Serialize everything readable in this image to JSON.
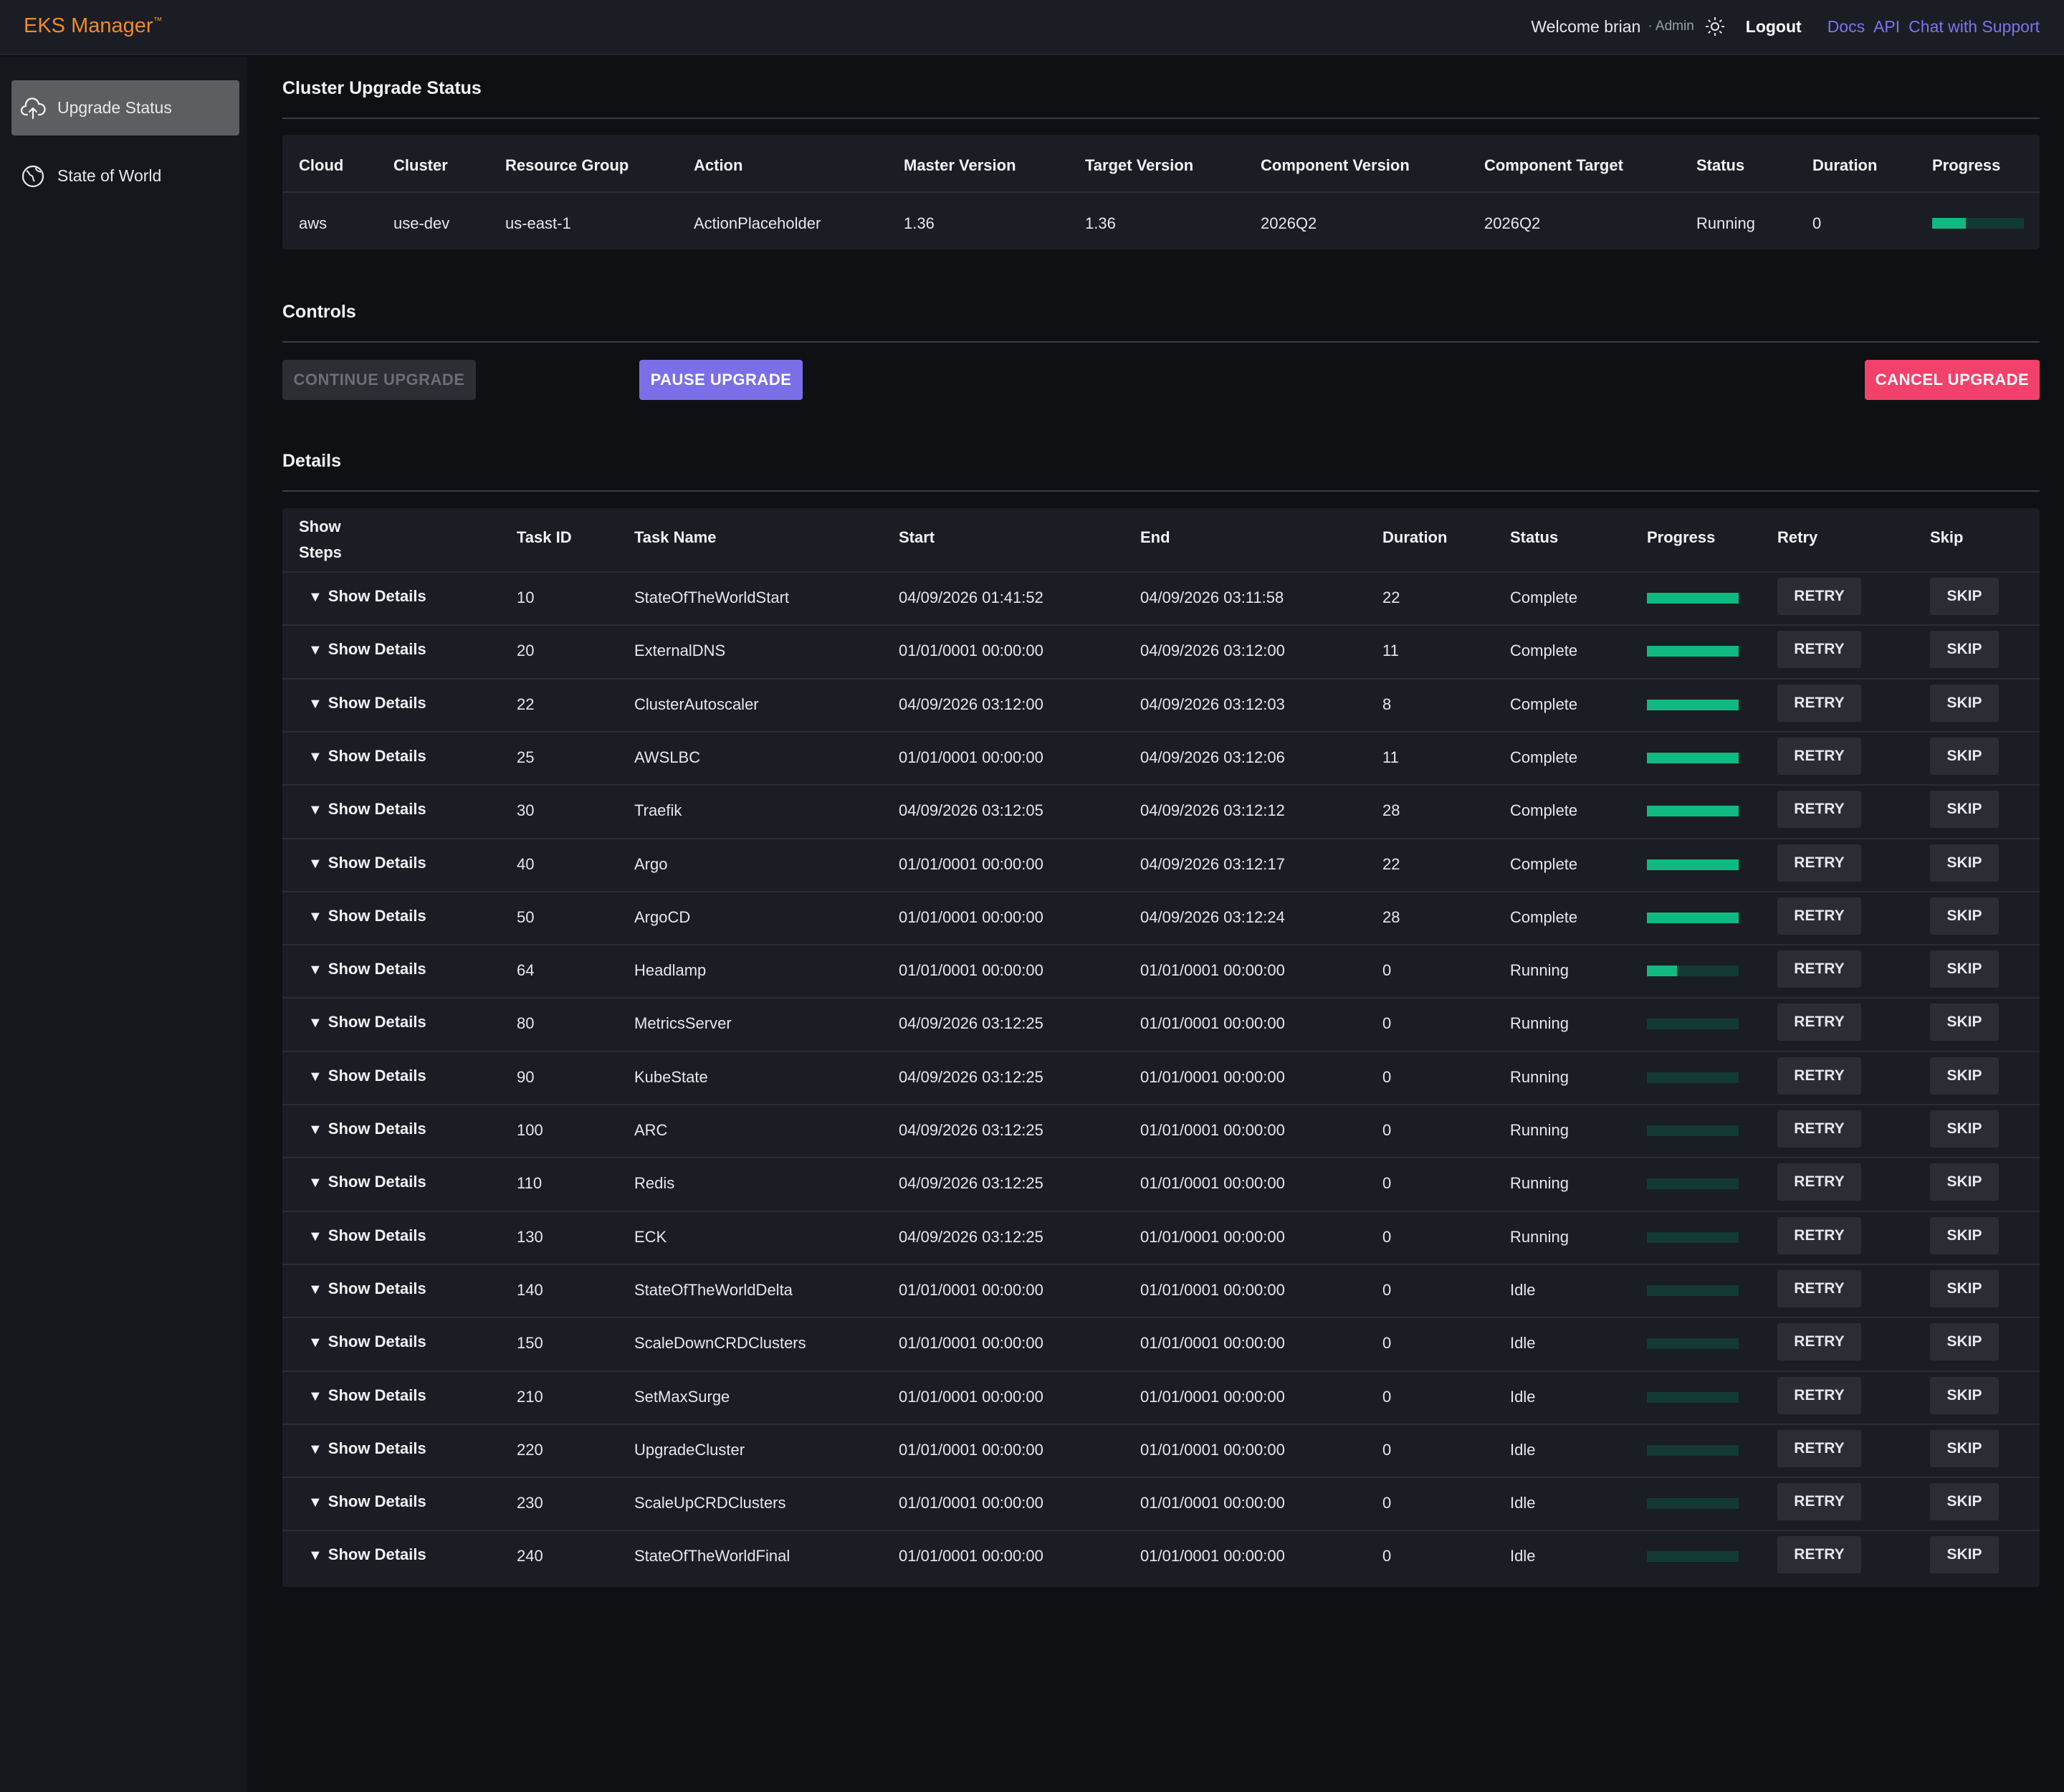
{
  "header": {
    "brand": "EKS Manager",
    "trademark": "™",
    "welcome": "Welcome brian",
    "role": "· Admin",
    "theme_icon": "sun-icon",
    "logout": "Logout",
    "links": [
      "Docs",
      "API",
      "Chat with Support"
    ],
    "colors": {
      "brand": "#f08a2a",
      "link": "#7c74f2"
    }
  },
  "sidebar": {
    "items": [
      {
        "label": "Upgrade Status",
        "icon": "cloud-upload-icon",
        "active": true
      },
      {
        "label": "State of World",
        "icon": "globe-icon",
        "active": false
      }
    ]
  },
  "upgrade_status": {
    "title": "Cluster Upgrade Status",
    "columns": [
      "Cloud",
      "Cluster",
      "Resource Group",
      "Action",
      "Master Version",
      "Target Version",
      "Component Version",
      "Component Target",
      "Status",
      "Duration",
      "Progress"
    ],
    "row": {
      "cloud": "aws",
      "cluster": "use-dev",
      "resource_group": "us-east-1",
      "action": "ActionPlaceholder",
      "master_version": "1.36",
      "target_version": "1.36",
      "component_version": "2026Q2",
      "component_target": "2026Q2",
      "status": "Running",
      "duration": "0",
      "progress": 0.37
    }
  },
  "controls": {
    "title": "Controls",
    "continue_label": "CONTINUE UPGRADE",
    "pause_label": "PAUSE UPGRADE",
    "cancel_label": "CANCEL UPGRADE",
    "colors": {
      "pause": "#7b6fe8",
      "cancel": "#f2416b",
      "progress": "#10b981"
    }
  },
  "details": {
    "title": "Details",
    "columns": {
      "show_steps_line1": "Show",
      "show_steps_line2": "Steps",
      "task_id": "Task ID",
      "task_name": "Task Name",
      "start": "Start",
      "end": "End",
      "duration": "Duration",
      "status": "Status",
      "progress": "Progress",
      "retry": "Retry",
      "skip": "Skip"
    },
    "show_details_label": "Show Details",
    "retry_label": "RETRY",
    "skip_label": "SKIP",
    "rows": [
      {
        "id": "10",
        "name": "StateOfTheWorldStart",
        "start": "04/09/2026 01:41:52",
        "end": "04/09/2026 03:11:58",
        "duration": "22",
        "status": "Complete",
        "progress": 1.0
      },
      {
        "id": "20",
        "name": "ExternalDNS",
        "start": "01/01/0001 00:00:00",
        "end": "04/09/2026 03:12:00",
        "duration": "11",
        "status": "Complete",
        "progress": 1.0
      },
      {
        "id": "22",
        "name": "ClusterAutoscaler",
        "start": "04/09/2026 03:12:00",
        "end": "04/09/2026 03:12:03",
        "duration": "8",
        "status": "Complete",
        "progress": 1.0
      },
      {
        "id": "25",
        "name": "AWSLBC",
        "start": "01/01/0001 00:00:00",
        "end": "04/09/2026 03:12:06",
        "duration": "11",
        "status": "Complete",
        "progress": 1.0
      },
      {
        "id": "30",
        "name": "Traefik",
        "start": "04/09/2026 03:12:05",
        "end": "04/09/2026 03:12:12",
        "duration": "28",
        "status": "Complete",
        "progress": 1.0
      },
      {
        "id": "40",
        "name": "Argo",
        "start": "01/01/0001 00:00:00",
        "end": "04/09/2026 03:12:17",
        "duration": "22",
        "status": "Complete",
        "progress": 1.0
      },
      {
        "id": "50",
        "name": "ArgoCD",
        "start": "01/01/0001 00:00:00",
        "end": "04/09/2026 03:12:24",
        "duration": "28",
        "status": "Complete",
        "progress": 1.0
      },
      {
        "id": "64",
        "name": "Headlamp",
        "start": "01/01/0001 00:00:00",
        "end": "01/01/0001 00:00:00",
        "duration": "0",
        "status": "Running",
        "progress": 0.33
      },
      {
        "id": "80",
        "name": "MetricsServer",
        "start": "04/09/2026 03:12:25",
        "end": "01/01/0001 00:00:00",
        "duration": "0",
        "status": "Running",
        "progress": 0
      },
      {
        "id": "90",
        "name": "KubeState",
        "start": "04/09/2026 03:12:25",
        "end": "01/01/0001 00:00:00",
        "duration": "0",
        "status": "Running",
        "progress": 0
      },
      {
        "id": "100",
        "name": "ARC",
        "start": "04/09/2026 03:12:25",
        "end": "01/01/0001 00:00:00",
        "duration": "0",
        "status": "Running",
        "progress": 0
      },
      {
        "id": "110",
        "name": "Redis",
        "start": "04/09/2026 03:12:25",
        "end": "01/01/0001 00:00:00",
        "duration": "0",
        "status": "Running",
        "progress": 0
      },
      {
        "id": "130",
        "name": "ECK",
        "start": "04/09/2026 03:12:25",
        "end": "01/01/0001 00:00:00",
        "duration": "0",
        "status": "Running",
        "progress": 0
      },
      {
        "id": "140",
        "name": "StateOfTheWorldDelta",
        "start": "01/01/0001 00:00:00",
        "end": "01/01/0001 00:00:00",
        "duration": "0",
        "status": "Idle",
        "progress": 0
      },
      {
        "id": "150",
        "name": "ScaleDownCRDClusters",
        "start": "01/01/0001 00:00:00",
        "end": "01/01/0001 00:00:00",
        "duration": "0",
        "status": "Idle",
        "progress": 0
      },
      {
        "id": "210",
        "name": "SetMaxSurge",
        "start": "01/01/0001 00:00:00",
        "end": "01/01/0001 00:00:00",
        "duration": "0",
        "status": "Idle",
        "progress": 0
      },
      {
        "id": "220",
        "name": "UpgradeCluster",
        "start": "01/01/0001 00:00:00",
        "end": "01/01/0001 00:00:00",
        "duration": "0",
        "status": "Idle",
        "progress": 0
      },
      {
        "id": "230",
        "name": "ScaleUpCRDClusters",
        "start": "01/01/0001 00:00:00",
        "end": "01/01/0001 00:00:00",
        "duration": "0",
        "status": "Idle",
        "progress": 0
      },
      {
        "id": "240",
        "name": "StateOfTheWorldFinal",
        "start": "01/01/0001 00:00:00",
        "end": "01/01/0001 00:00:00",
        "duration": "0",
        "status": "Idle",
        "progress": 0
      }
    ]
  }
}
